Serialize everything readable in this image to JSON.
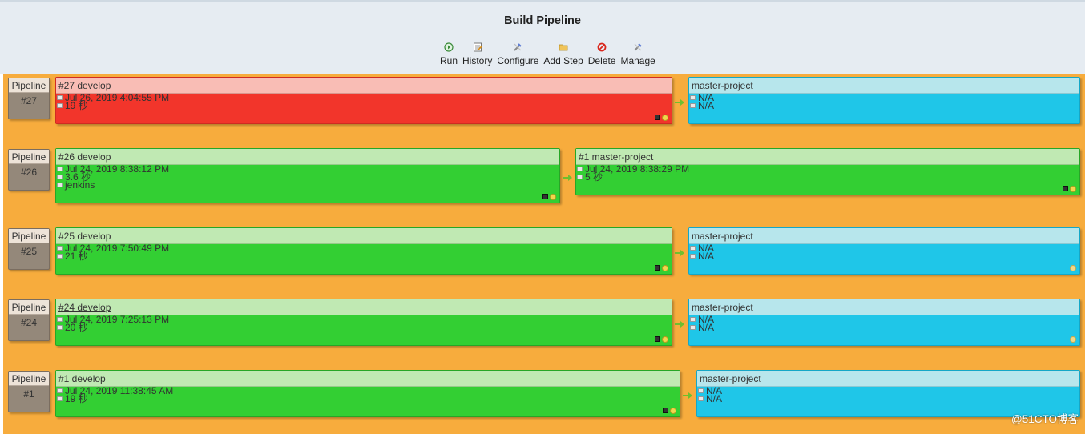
{
  "header": {
    "title": "Build Pipeline",
    "toolbar": [
      {
        "label": "Run",
        "icon": "run-icon"
      },
      {
        "label": "History",
        "icon": "history-icon"
      },
      {
        "label": "Configure",
        "icon": "configure-icon"
      },
      {
        "label": "Add Step",
        "icon": "add-step-icon"
      },
      {
        "label": "Delete",
        "icon": "delete-icon"
      },
      {
        "label": "Manage",
        "icon": "manage-icon"
      }
    ]
  },
  "colors": {
    "canvas": "#f7ac3d",
    "failed": "#f2352b",
    "success": "#33cf33",
    "pending": "#1fc6e8"
  },
  "pipelines": [
    {
      "label": "Pipeline",
      "number": "#27",
      "build": {
        "title": "#27 develop",
        "status": "failed",
        "time": "Jul 26, 2019 4:04:55 PM",
        "duration": "19 秒",
        "user": ""
      },
      "downstream": {
        "title": "master-project",
        "status": "pending",
        "time": "N/A",
        "duration": "N/A"
      }
    },
    {
      "label": "Pipeline",
      "number": "#26",
      "build": {
        "title": "#26 develop",
        "status": "success",
        "time": "Jul 24, 2019 8:38:12 PM",
        "duration": "3.6 秒",
        "user": "jenkins"
      },
      "downstream": {
        "title": "#1 master-project",
        "status": "success",
        "time": "Jul 24, 2019 8:38:29 PM",
        "duration": "5 秒"
      }
    },
    {
      "label": "Pipeline",
      "number": "#25",
      "build": {
        "title": "#25 develop",
        "status": "success",
        "time": "Jul 24, 2019 7:50:49 PM",
        "duration": "21 秒",
        "user": ""
      },
      "downstream": {
        "title": "master-project",
        "status": "pending",
        "time": "N/A",
        "duration": "N/A"
      }
    },
    {
      "label": "Pipeline",
      "number": "#24",
      "build": {
        "title": "#24 develop",
        "status": "success",
        "time": "Jul 24, 2019 7:25:13 PM",
        "duration": "20 秒",
        "user": ""
      },
      "downstream": {
        "title": "master-project",
        "status": "pending",
        "time": "N/A",
        "duration": "N/A"
      }
    },
    {
      "label": "Pipeline",
      "number": "#1",
      "build": {
        "title": "#1 develop",
        "status": "success",
        "time": "Jul 24, 2019 11:38:45 AM",
        "duration": "19 秒",
        "user": ""
      },
      "downstream": {
        "title": "master-project",
        "status": "pending",
        "time": "N/A",
        "duration": "N/A"
      }
    }
  ],
  "watermark": "@51CTO博客"
}
